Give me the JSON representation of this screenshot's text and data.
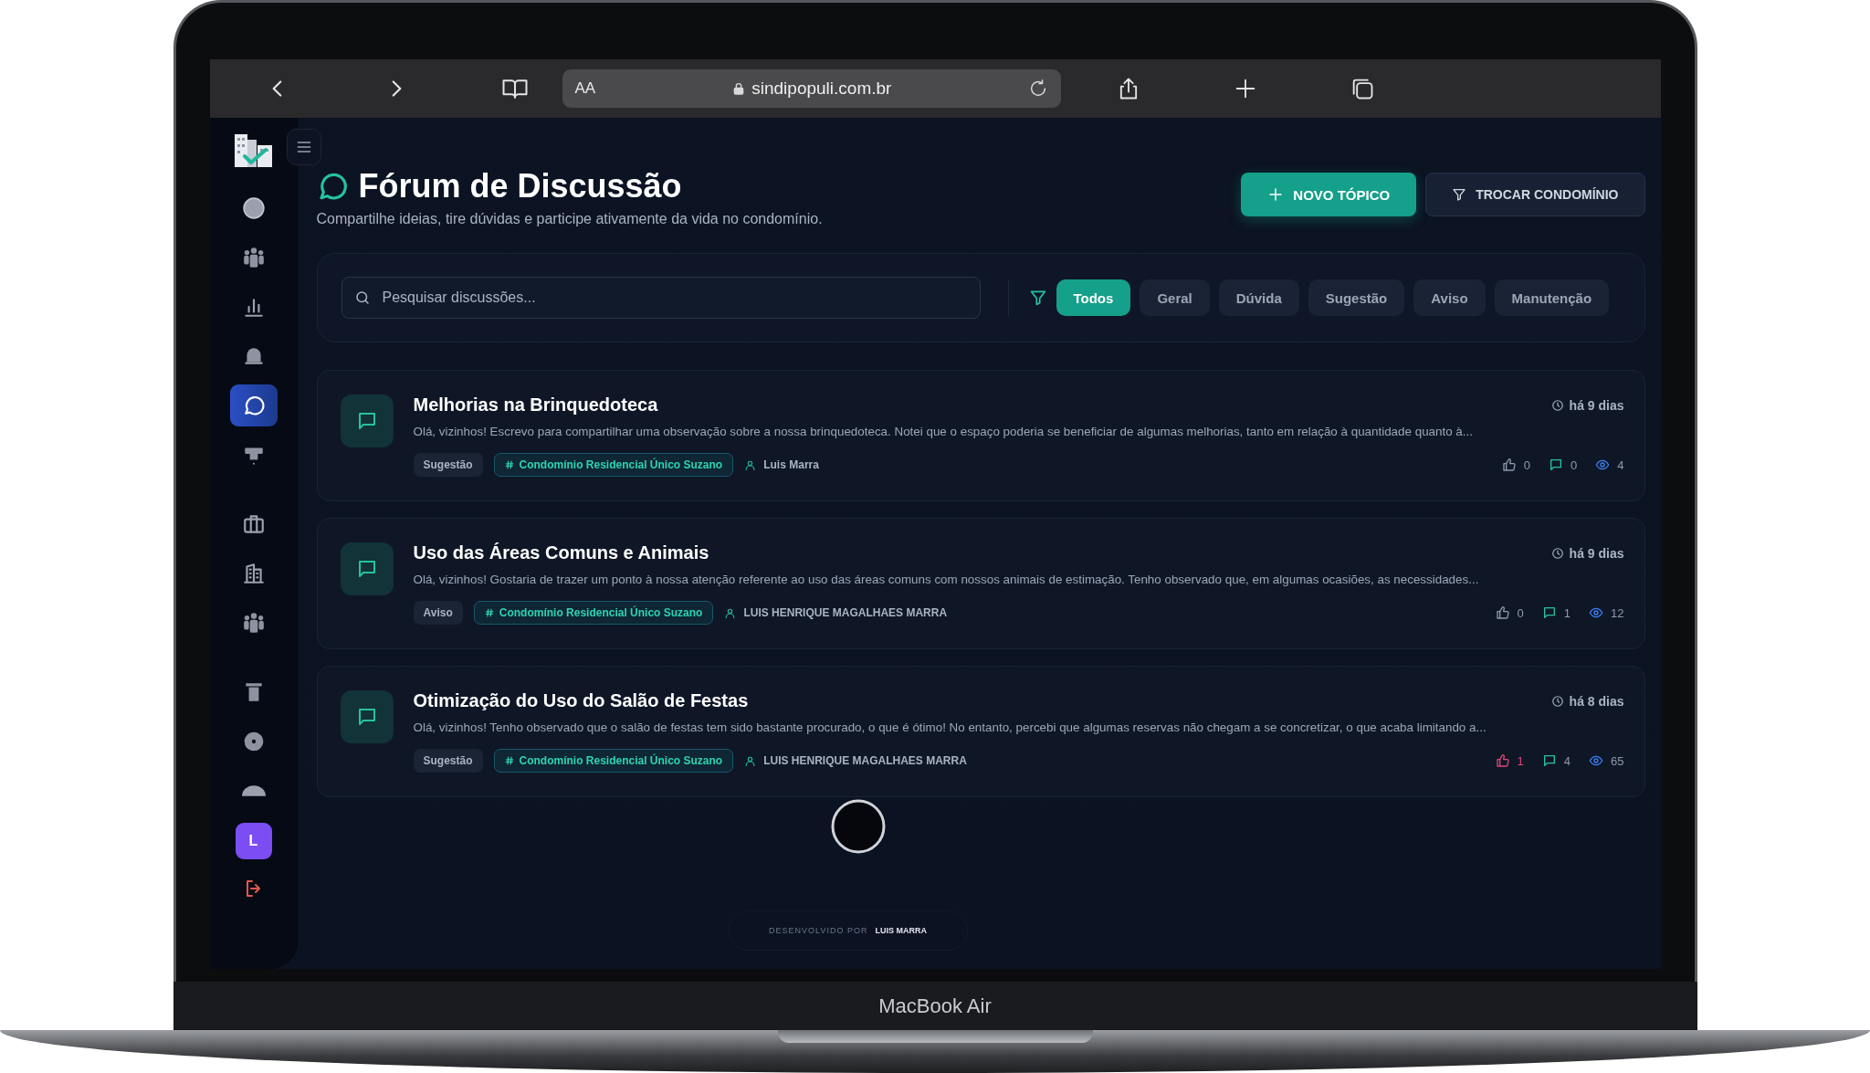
{
  "browser": {
    "reader_label": "AA",
    "url": "sindipopuli.com.br"
  },
  "sidebar": {
    "items": [
      {
        "kind": "circle",
        "selected": false
      },
      {
        "kind": "people",
        "selected": false
      },
      {
        "kind": "chart",
        "selected": false
      },
      {
        "kind": "bell",
        "selected": false
      },
      {
        "kind": "chat",
        "selected": true
      },
      {
        "kind": "podium",
        "selected": false
      },
      {
        "kind": "briefcase",
        "selected": false
      },
      {
        "kind": "building",
        "selected": false
      },
      {
        "kind": "people",
        "selected": false
      },
      {
        "kind": "pillar",
        "selected": false
      },
      {
        "kind": "gear",
        "selected": false
      },
      {
        "kind": "dome",
        "selected": false
      }
    ],
    "avatar": "L"
  },
  "header": {
    "title": "Fórum de Discussão",
    "subtitle": "Compartilhe ideias, tire dúvidas e participe ativamente da vida no condomínio.",
    "buttons": [
      {
        "kind": "primary",
        "label": "NOVO TÓPICO"
      },
      {
        "kind": "secondary",
        "label": "TROCAR CONDOMÍNIO"
      }
    ]
  },
  "search": {
    "placeholder": "Pesquisar discussões..."
  },
  "filters": [
    {
      "label": "Todos",
      "selected": true
    },
    {
      "label": "Geral",
      "selected": false
    },
    {
      "label": "Dúvida",
      "selected": false
    },
    {
      "label": "Sugestão",
      "selected": false
    },
    {
      "label": "Aviso",
      "selected": false
    },
    {
      "label": "Manutenção",
      "selected": false
    }
  ],
  "topics": [
    {
      "title": "Melhorias na Brinquedoteca",
      "time": "há 9 dias",
      "excerpt": "Olá, vizinhos! Escrevo para compartilhar uma observação sobre a nossa brinquedoteca. Notei que o espaço poderia se beneficiar de algumas melhorias, tanto em relação à quantidade quanto à...",
      "category": "Sugestão",
      "condo": "Condomínio Residencial Único Suzano",
      "author": "Luis Marra",
      "likes": "0",
      "liked": false,
      "comments": "0",
      "views": "4"
    },
    {
      "title": "Uso das Áreas Comuns e Animais",
      "time": "há 9 dias",
      "excerpt": "Olá, vizinhos! Gostaria de trazer um ponto à nossa atenção referente ao uso das áreas comuns com nossos animais de estimação. Tenho observado que, em algumas ocasiões, as necessidades...",
      "category": "Aviso",
      "condo": "Condomínio Residencial Único Suzano",
      "author": "LUIS HENRIQUE MAGALHAES MARRA",
      "likes": "0",
      "liked": false,
      "comments": "1",
      "views": "12"
    },
    {
      "title": "Otimização do Uso do Salão de Festas",
      "time": "há 8 dias",
      "excerpt": "Olá, vizinhos! Tenho observado que o salão de festas tem sido bastante procurado, o que é ótimo! No entanto, percebi que algumas reservas não chegam a se concretizar, o que acaba limitando a...",
      "category": "Sugestão",
      "condo": "Condomínio Residencial Único Suzano",
      "author": "LUIS HENRIQUE MAGALHAES MARRA",
      "likes": "1",
      "liked": true,
      "comments": "4",
      "views": "65"
    }
  ],
  "footer": {
    "prefix": "DESENVOLVIDO POR",
    "author": "LUIS MARRA"
  },
  "device_label": "MacBook Air"
}
